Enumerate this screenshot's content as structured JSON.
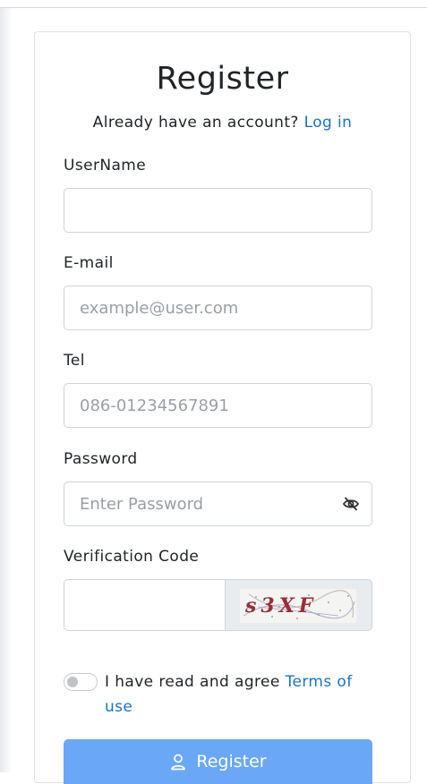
{
  "form": {
    "title": "Register",
    "login_prompt": "Already have an account?",
    "login_link": "Log in",
    "username": {
      "label": "UserName",
      "placeholder": ""
    },
    "email": {
      "label": "E-mail",
      "placeholder": "example@user.com"
    },
    "tel": {
      "label": "Tel",
      "placeholder": "086-01234567891"
    },
    "password": {
      "label": "Password",
      "placeholder": "Enter Password",
      "toggle_icon": "eye-slash-icon"
    },
    "verification": {
      "label": "Verification Code",
      "placeholder": "",
      "captcha_text": "s3XF"
    },
    "agree": {
      "text": "I have read and agree",
      "link": "Terms of use",
      "checked": false
    },
    "submit": {
      "label": "Register",
      "icon": "user-icon"
    }
  },
  "colors": {
    "accent": "#1a73c8",
    "button": "#6aa8f7",
    "border": "#ced4da",
    "captcha_bg": "#e9ecef"
  }
}
